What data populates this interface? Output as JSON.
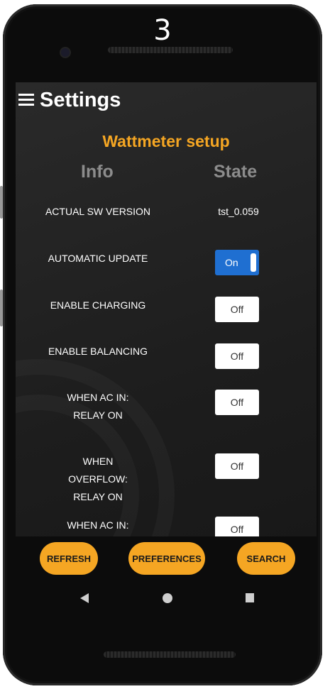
{
  "device": {
    "tag_number": "3"
  },
  "app_bar": {
    "title": "Settings",
    "menu_icon": "hamburger-menu-icon"
  },
  "section": {
    "title": "Wattmeter setup",
    "header_info": "Info",
    "header_state": "State"
  },
  "rows": [
    {
      "label": "ACTUAL SW VERSION",
      "value": "tst_0.059"
    },
    {
      "label": "AUTOMATIC UPDATE",
      "toggle": "On"
    },
    {
      "label": "ENABLE CHARGING",
      "toggle": "Off"
    },
    {
      "label": "ENABLE BALANCING",
      "toggle": "Off"
    },
    {
      "label": "WHEN AC IN: RELAY ON",
      "toggle": "Off"
    },
    {
      "label": "WHEN OVERFLOW: RELAY ON",
      "toggle": "Off"
    },
    {
      "label": "WHEN AC IN:",
      "toggle": "Off"
    }
  ],
  "buttons": {
    "refresh": "REFRESH",
    "preferences": "PREFERENCES",
    "search": "SEARCH"
  },
  "nav": {
    "back": "back-triangle-icon",
    "home": "home-circle-icon",
    "recents": "recents-square-icon"
  },
  "colors": {
    "accent": "#f5a623",
    "toggle_on": "#1f6fd1",
    "header_gray": "#8c8c8c"
  }
}
